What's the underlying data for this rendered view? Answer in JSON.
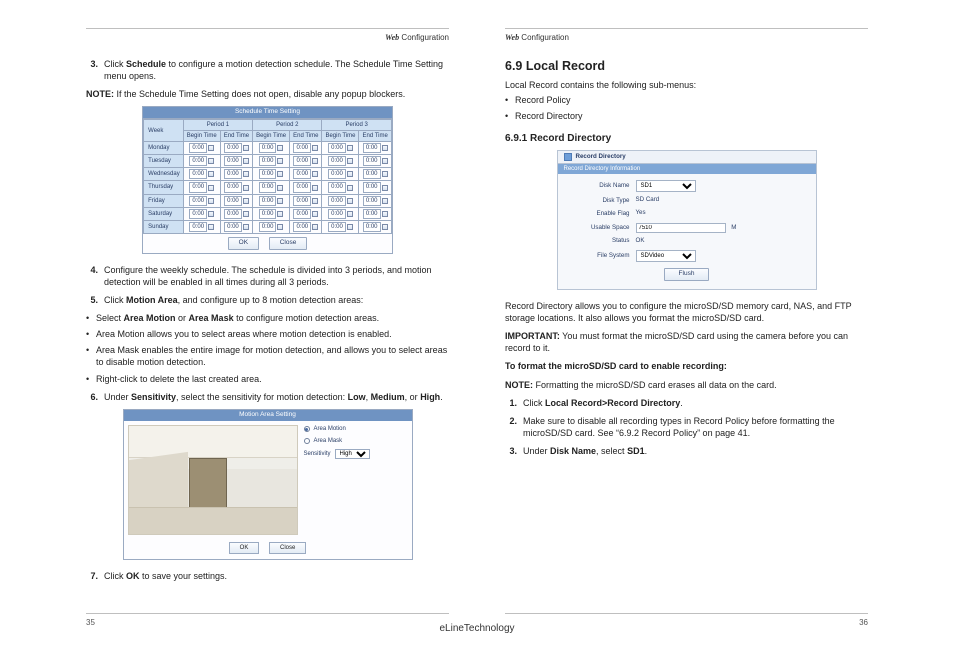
{
  "running_head": {
    "web": "Web",
    "rest": " Configuration"
  },
  "left": {
    "steps_a": [
      {
        "n": "3.",
        "html_parts": [
          "Click ",
          "Schedule",
          " to configure a motion detection schedule. The Schedule Time Setting menu opens."
        ]
      }
    ],
    "note1_label": "NOTE:",
    "note1_text": " If the Schedule Time Setting does not open, disable any popup blockers.",
    "sched": {
      "caption": "Schedule Time Setting",
      "week_header": "Week",
      "period_labels": [
        "Period 1",
        "Period 2",
        "Period 3"
      ],
      "sub_headers": [
        "Begin Time",
        "End Time"
      ],
      "days": [
        "Monday",
        "Tuesday",
        "Wednesday",
        "Thursday",
        "Friday",
        "Saturday",
        "Sunday"
      ],
      "begin": "0:00",
      "end": "0:00",
      "btn_ok": "OK",
      "btn_close": "Close"
    },
    "steps_b": [
      {
        "n": "4.",
        "text": "Configure the weekly schedule. The schedule is divided into 3 periods, and motion detection will be enabled in all times during all 3 periods."
      },
      {
        "n": "5.",
        "html_parts": [
          "Click ",
          "Motion Area",
          ", and configure up to 8 motion detection areas:"
        ]
      }
    ],
    "bullets5": [
      {
        "html_parts": [
          "Select ",
          "Area Motion",
          " or ",
          "Area Mask",
          " to configure motion detection areas."
        ]
      },
      {
        "text": "Area Motion allows you to select areas where motion detection is enabled."
      },
      {
        "text": "Area Mask enables the entire image for motion detection, and allows you to select areas to disable motion detection."
      },
      {
        "text": "Right-click to delete the last created area."
      }
    ],
    "step6": {
      "n": "6.",
      "html_parts": [
        "Under ",
        "Sensitivity",
        ", select the sensitivity for motion detection: ",
        "Low",
        ", ",
        "Medium",
        ", or ",
        "High",
        "."
      ]
    },
    "motion_fig": {
      "caption": "Motion Area Setting",
      "opt_motion": "Area Motion",
      "opt_mask": "Area Mask",
      "sens_label": "Sensitivity",
      "sens_value": "High",
      "btn_ok": "OK",
      "btn_close": "Close"
    },
    "step7": {
      "n": "7.",
      "html_parts": [
        "Click ",
        "OK",
        " to save your settings."
      ]
    },
    "page_number": "35"
  },
  "right": {
    "h2": "6.9  Local Record",
    "intro": "Local Record contains the following sub-menus:",
    "submenus": [
      "Record Policy",
      "Record Directory"
    ],
    "h3": "6.9.1 Record Directory",
    "panel": {
      "tab_title": "Record Directory",
      "subbar": "Record Directory Information",
      "rows": {
        "disk_name_label": "Disk Name",
        "disk_name_value": "SD1",
        "disk_type_label": "Disk Type",
        "disk_type_value": "SD Card",
        "enable_flag_label": "Enable Flag",
        "enable_flag_value": "Yes",
        "usable_space_label": "Usable Space",
        "usable_space_value": "7510",
        "usable_space_unit": "M",
        "status_label": "Status",
        "status_value": "OK",
        "file_system_label": "File System",
        "file_system_value": "SDVideo"
      },
      "btn_flush": "Flush"
    },
    "para1": "Record Directory allows you to configure the microSD/SD memory card, NAS, and FTP storage locations. It also allows you format the microSD/SD card.",
    "important_label": "IMPORTANT:",
    "important_text": " You must format the microSD/SD card using the camera before you can record to it.",
    "format_heading": "To format the microSD/SD card to enable recording:",
    "note2_label": "NOTE:",
    "note2_text": " Formatting the microSD/SD card erases all data on the card.",
    "steps": [
      {
        "n": "1.",
        "html_parts": [
          "Click ",
          "Local Record>Record Directory",
          "."
        ]
      },
      {
        "n": "2.",
        "text": "Make sure to disable all recording types in Record Policy before formatting the microSD/SD card. See “6.9.2 Record Policy” on page 41."
      },
      {
        "n": "3.",
        "html_parts": [
          "Under ",
          "Disk Name",
          ", select ",
          "SD1",
          "."
        ]
      }
    ],
    "page_number": "36"
  },
  "brand": "eLineTechnology"
}
